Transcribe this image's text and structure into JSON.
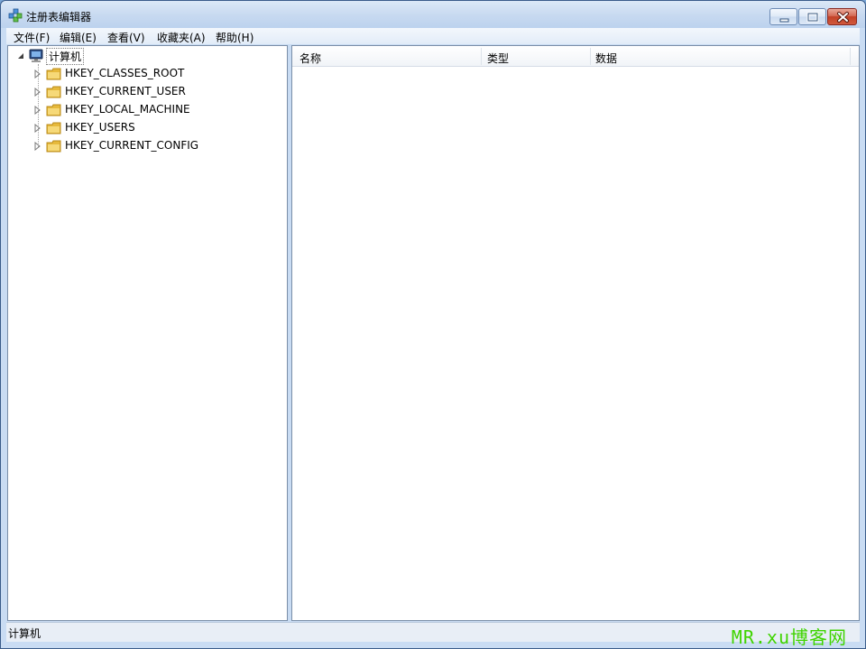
{
  "window": {
    "title": "注册表编辑器",
    "controls": {
      "minimize": "minimize",
      "maximize": "maximize",
      "close": "close"
    }
  },
  "menu": {
    "items": [
      {
        "label": "文件(F)"
      },
      {
        "label": "编辑(E)"
      },
      {
        "label": "查看(V)"
      },
      {
        "label": "收藏夹(A)"
      },
      {
        "label": "帮助(H)"
      }
    ]
  },
  "tree": {
    "root": {
      "label": "计算机",
      "icon": "computer-icon"
    },
    "items": [
      {
        "label": "HKEY_CLASSES_ROOT",
        "icon": "folder-icon"
      },
      {
        "label": "HKEY_CURRENT_USER",
        "icon": "folder-icon"
      },
      {
        "label": "HKEY_LOCAL_MACHINE",
        "icon": "folder-icon"
      },
      {
        "label": "HKEY_USERS",
        "icon": "folder-icon"
      },
      {
        "label": "HKEY_CURRENT_CONFIG",
        "icon": "folder-icon"
      }
    ]
  },
  "list": {
    "columns": [
      {
        "label": "名称"
      },
      {
        "label": "类型"
      },
      {
        "label": "数据"
      }
    ]
  },
  "status": {
    "path": "计算机"
  },
  "watermark": "MR.xu博客网",
  "colors": {
    "titlebar": "#c7d9f0",
    "close_button": "#c24026",
    "watermark": "#3fd400"
  }
}
